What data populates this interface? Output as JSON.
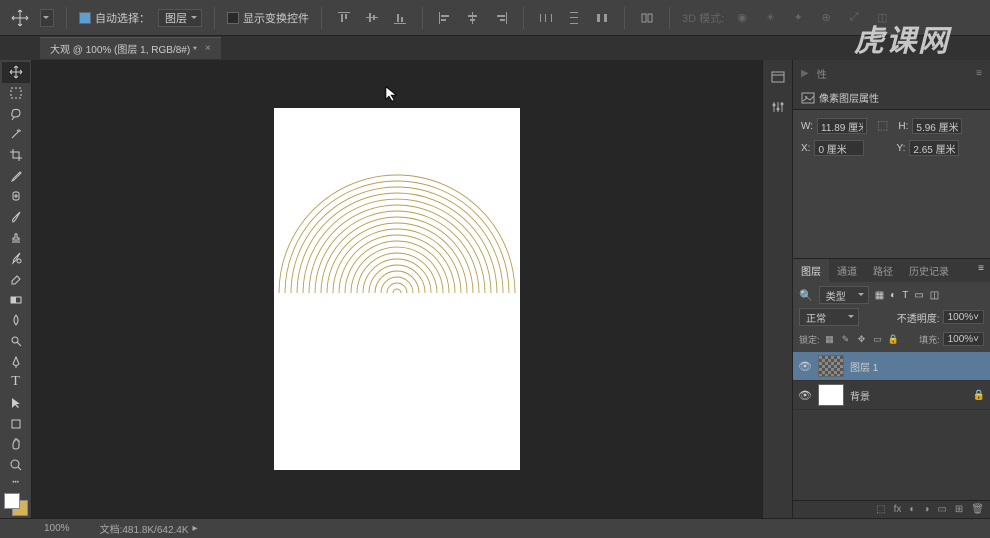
{
  "topbar": {
    "auto_select_label": "自动选择：",
    "auto_select_value": "图层",
    "show_transform_label": "显示变换控件",
    "threeDMode": "3D 模式:"
  },
  "doc_tab": {
    "title": "大观 @ 100% (图层 1, RGB/8#) *"
  },
  "properties": {
    "title": "像素图层属性",
    "w_label": "W:",
    "w_value": "11.89 厘米",
    "h_label": "H:",
    "h_value": "5.96 厘米",
    "x_label": "X:",
    "x_value": "0 厘米",
    "y_label": "Y:",
    "y_value": "2.65 厘米"
  },
  "layers_panel": {
    "tabs": [
      "图层",
      "通道",
      "路径",
      "历史记录"
    ],
    "filter_label": "类型",
    "blend_mode": "正常",
    "opacity_label": "不透明度:",
    "opacity_value": "100%",
    "lock_label": "锁定:",
    "fill_label": "填充:",
    "fill_value": "100%",
    "items": [
      {
        "name": "图层 1"
      },
      {
        "name": "背景"
      }
    ]
  },
  "status": {
    "zoom": "100%",
    "doc_info": "文档:481.8K/642.4K"
  },
  "watermark": "虎课网"
}
